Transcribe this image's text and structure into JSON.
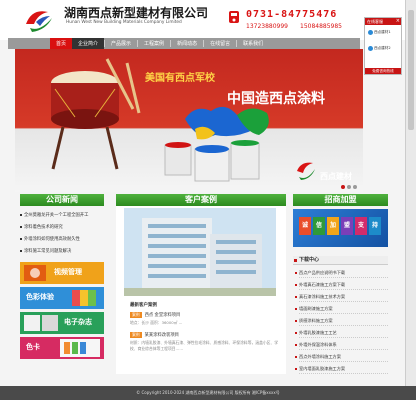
{
  "header": {
    "brand_cn": "湖南西点新型建材有限公司",
    "brand_en": "Hunan West New Building Materials Company Limited",
    "phone_main": "0731-84775476",
    "phone_mobile1": "13723880999",
    "phone_mobile2": "15084885985"
  },
  "nav": {
    "items": [
      "首页",
      "企业简介",
      "产品展示",
      "工程案例",
      "新闻动态",
      "在线留言",
      "联系我们"
    ]
  },
  "float_panel": {
    "title": "在线客服",
    "close": "×",
    "qq1": "西点建材1",
    "qq2": "西点建材2",
    "footer": "免费咨询热线"
  },
  "banner": {
    "line1": "美国有西点军校",
    "line2": "中国造西点涂料",
    "brand": "西点建材"
  },
  "left": {
    "title": "公司新闻",
    "news": [
      "全州莫雅龙开关一个工程全国开工",
      "涂料着色技术的研究",
      "外墙涂料如何使用高效耐久性",
      "涂料施工常见问题及解决"
    ],
    "tiles": [
      "视频管理",
      "色彩体验",
      "电子杂志",
      "色卡"
    ]
  },
  "middle": {
    "title": "客户案例",
    "case_head": "最新客户案例",
    "cases": [
      {
        "tag": "案例",
        "text": "西点 金堂涂料项目"
      },
      {
        "tag": "案例",
        "text": "某某涂料改装项目"
      }
    ],
    "desc1": "地点：长沙  面积：36000㎡  ...",
    "desc2": "材质：内墙乳胶漆、外墙真石漆、弹性拉毛涂料、质感涂料、环保涂料等，涵盖小区、学校、商业综合体等工程项目……"
  },
  "right": {
    "title": "招商加盟",
    "join_chars": [
      "诚",
      "信",
      "加",
      "盟",
      "支",
      "持"
    ],
    "dl_head": "下载中心",
    "downloads": [
      "西点产品供应说明书下载",
      "外墙真石漆施工方案下载",
      "真石漆涂料施工技术方案",
      "墙面刷漆施工方案",
      "质感涂料施工方案",
      "外墙乳胶漆施工工艺",
      "外墙外保温涂料体系",
      "西点外墙涂料施工方案",
      "室内墙面乳胶漆施工方案"
    ]
  },
  "footer": {
    "text": "© Copyright 2010-2024 湖南西点新型建材有限公司 版权所有  湘ICP备xxxx号"
  },
  "colors": {
    "accent_red": "#d91010",
    "section_green": "#2c8a1f",
    "join_blue": "#1452a3"
  }
}
